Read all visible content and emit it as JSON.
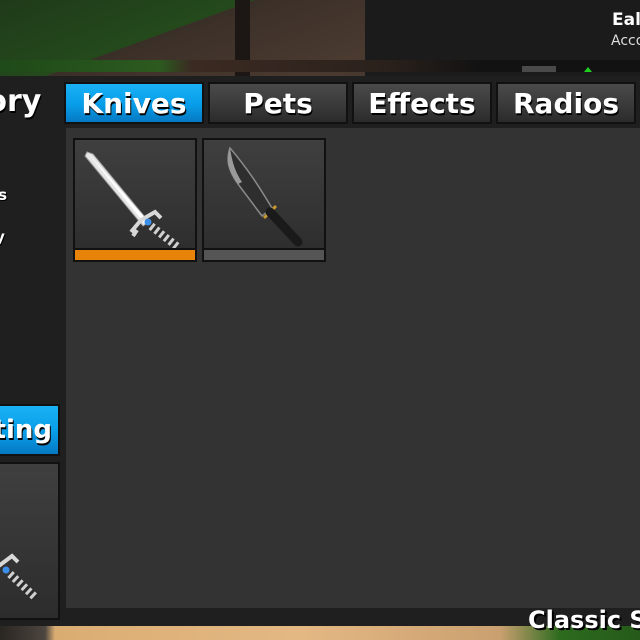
{
  "hud": {
    "player_name": "Eal",
    "player_subtitle": "Acco"
  },
  "inventory": {
    "title": "tory",
    "side_items": [
      "es",
      "ty"
    ],
    "tabs": [
      {
        "label": "Knives",
        "active": true
      },
      {
        "label": "Pets",
        "active": false
      },
      {
        "label": "Effects",
        "active": false
      },
      {
        "label": "Radios",
        "active": false
      }
    ],
    "items": [
      {
        "name": "ice-sword",
        "rarity_color": "#e8830a"
      },
      {
        "name": "black-bowie-knife",
        "rarity_color": "#555555"
      }
    ],
    "crafting_label": "fting"
  },
  "footer": {
    "server_label": "Classic Se"
  },
  "colors": {
    "accent_blue": "#089de8",
    "panel_bg": "#333333",
    "rarity_orange": "#e8830a",
    "rarity_common": "#555555"
  }
}
